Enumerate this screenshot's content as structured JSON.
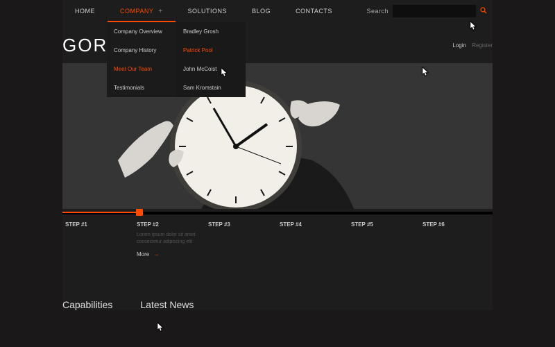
{
  "nav": {
    "items": [
      {
        "label": "HOME"
      },
      {
        "label": "COMPANY"
      },
      {
        "label": "SOLUTIONS"
      },
      {
        "label": "BLOG"
      },
      {
        "label": "CONTACTS"
      }
    ],
    "company_submenu": [
      {
        "label": "Company Overview"
      },
      {
        "label": "Company History"
      },
      {
        "label": "Meet Our Team"
      },
      {
        "label": "Testimonials"
      }
    ],
    "team_submenu": [
      {
        "label": "Bradley Grosh"
      },
      {
        "label": "Patrick Pool"
      },
      {
        "label": "John McCoist"
      },
      {
        "label": "Sam Kromstain"
      }
    ]
  },
  "search": {
    "label": "Search",
    "placeholder": ""
  },
  "brand": {
    "logo": "GOR"
  },
  "auth": {
    "login": "Login",
    "register": "Register"
  },
  "steps": {
    "items": [
      {
        "title": "STEP #1"
      },
      {
        "title": "STEP #2",
        "body": "Lorem ipsum dolor sit amet consectetur adipiscing elit",
        "more": "More"
      },
      {
        "title": "STEP #3"
      },
      {
        "title": "STEP #4"
      },
      {
        "title": "STEP #5"
      },
      {
        "title": "STEP #6"
      }
    ]
  },
  "bottom": {
    "capabilities": "Capabilities",
    "latest_news": "Latest News"
  },
  "colors": {
    "accent": "#ff4a00",
    "bg": "#1d1d1d"
  }
}
